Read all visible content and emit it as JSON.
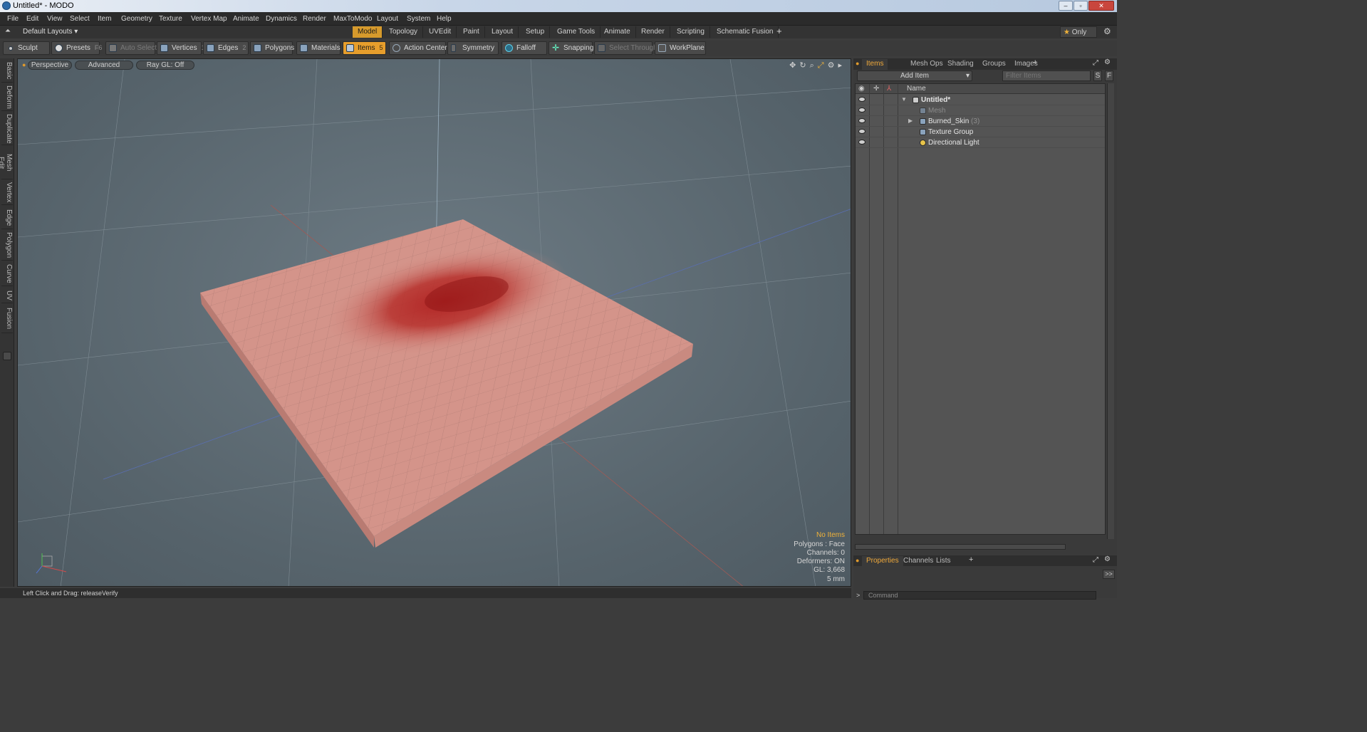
{
  "window": {
    "title": "Untitled* - MODO"
  },
  "menubar": {
    "items": [
      "File",
      "Edit",
      "View",
      "Select",
      "Item",
      "Geometry",
      "Texture",
      "Vertex Map",
      "Animate",
      "Dynamics",
      "Render",
      "MaxToModo",
      "Layout",
      "System",
      "Help"
    ]
  },
  "layouts": {
    "dropdown": "Default Layouts",
    "tabs": [
      "Model",
      "Topology",
      "UVEdit",
      "Paint",
      "Layout",
      "Setup",
      "Game Tools",
      "Animate",
      "Render",
      "Scripting",
      "Schematic Fusion"
    ],
    "active": "Model",
    "add": "+",
    "only": "Only"
  },
  "toolbar": {
    "sculpt": "Sculpt",
    "presets": "Presets",
    "presets_key": "F6",
    "auto_select": "Auto Select",
    "vertices": "Vertices",
    "vertices_key": "1",
    "edges": "Edges",
    "edges_key": "2",
    "polygons": "Polygons",
    "materials": "Materials",
    "items": "Items",
    "items_key": "5",
    "action_center": "Action Center",
    "symmetry": "Symmetry",
    "falloff": "Falloff",
    "snapping": "Snapping",
    "select_through": "Select Through",
    "workplane": "WorkPlane"
  },
  "left_tabs": [
    "Basic",
    "Deform",
    "Duplicate",
    "Mesh Edit",
    "Vertex",
    "Edge",
    "Polygon",
    "Curve",
    "UV",
    "Fusion"
  ],
  "viewport": {
    "perspective": "Perspective",
    "advanced": "Advanced",
    "raygl": "Ray GL: Off",
    "stats": {
      "items": "No Items",
      "polygons": "Polygons : Face",
      "channels": "Channels: 0",
      "deformers": "Deformers: ON",
      "gl": "GL: 3,668",
      "unit": "5 mm"
    }
  },
  "status": {
    "text": "Left Click and Drag:  releaseVerify"
  },
  "right_panel": {
    "tabs": [
      "Items",
      "Mesh Ops",
      "Shading",
      "Groups",
      "Images"
    ],
    "active_tab": "Items",
    "add_item": "Add Item",
    "filter_placeholder": "Filter Items",
    "s_btn": "S",
    "f_btn": "F",
    "column_name": "Name",
    "items": [
      {
        "label": "Untitled*"
      },
      {
        "label": "Mesh"
      },
      {
        "label": "Burned_Skin",
        "count": "(3)"
      },
      {
        "label": "Texture Group"
      },
      {
        "label": "Directional Light"
      }
    ],
    "bottom_tabs": [
      "Properties",
      "Channels",
      "Lists"
    ],
    "bottom_active": "Properties",
    "expand": ">>",
    "command_placeholder": "Command"
  },
  "colors": {
    "accent": "#e79e2c",
    "viewport_bg": "#5e6b73",
    "skin": "#d4948a",
    "burn": "#b52a26"
  }
}
